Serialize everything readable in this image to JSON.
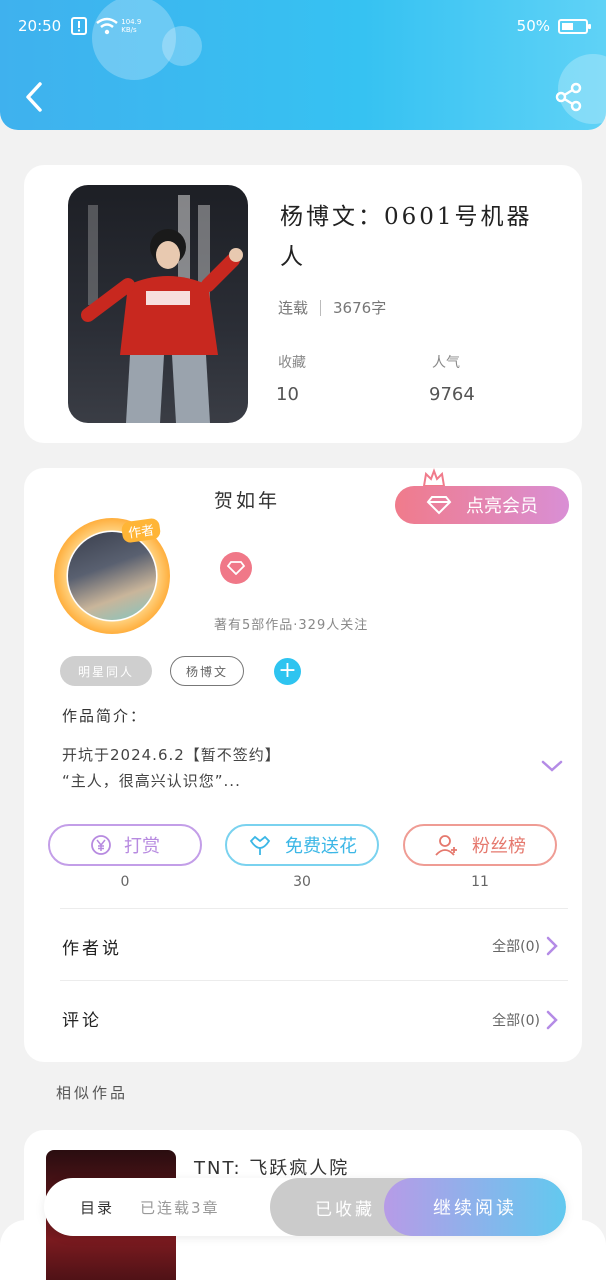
{
  "status_bar": {
    "time": "20:50",
    "net_speed_top": "104.9",
    "net_speed_bottom": "KB/s",
    "battery": "50%",
    "battery_level": 0.5
  },
  "book": {
    "title": "杨博文：0601号机器人",
    "status": "连载",
    "word_count": "3676字",
    "favorites_label": "收藏",
    "favorites_value": "10",
    "popularity_label": "人气",
    "popularity_value": "9764"
  },
  "author": {
    "badge": "作者",
    "name": "贺如年",
    "member_button": "点亮会员",
    "stats": "著有5部作品·329人关注",
    "tags": [
      "明星同人",
      "杨博文"
    ],
    "intro_label": "作品简介：",
    "intro_line1": "开坑于2024.6.2【暂不签约】",
    "intro_line2": "“主人，很高兴认识您”..."
  },
  "actions": [
    {
      "label": "打赏",
      "count": "0",
      "icon": "yen-coin-icon"
    },
    {
      "label": "免费送花",
      "count": "30",
      "icon": "flower-icon"
    },
    {
      "label": "粉丝榜",
      "count": "11",
      "icon": "fans-icon"
    }
  ],
  "author_says": {
    "label": "作者说",
    "right": "全部(0)"
  },
  "comments": {
    "label": "评论",
    "right": "全部(0)"
  },
  "similar": {
    "section_title": "相似作品",
    "first_title": "TNT: 飞跃疯人院"
  },
  "bottom_bar": {
    "toc": "目录",
    "chapters": "已连载3章",
    "favorited": "已收藏",
    "continue": "继续阅读"
  },
  "colors": {
    "header": "#3fb1ee",
    "accent_blue": "#2ec4f0",
    "accent_pink": "#f07b8b",
    "accent_purple": "#b78ae0"
  }
}
